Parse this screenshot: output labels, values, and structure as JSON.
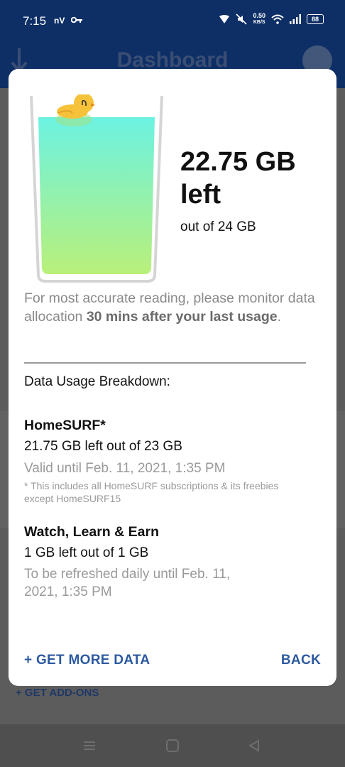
{
  "status_bar": {
    "time": "7:15",
    "carrier": "nV",
    "speed_value": "0.50",
    "speed_unit": "KB/S",
    "battery": "88"
  },
  "app_header": {
    "title": "Dashboard"
  },
  "dialog": {
    "remaining": "22.75 GB left",
    "total": "out of 24 GB",
    "note_prefix": "For most accurate reading, please monitor data allocation ",
    "note_bold": "30 mins after your last usage",
    "note_suffix": ".",
    "breakdown_title": "Data Usage Breakdown:",
    "items": [
      {
        "name": "HomeSURF*",
        "left": "21.75 GB left out of 23 GB",
        "valid": "Valid until Feb. 11, 2021, 1:35 PM",
        "footnote": "* This includes all HomeSURF subscriptions & its freebies except HomeSURF15"
      },
      {
        "name": "Watch, Learn & Earn",
        "left": "1 GB left out of 1 GB",
        "valid": "To be refreshed daily until Feb. 11, 2021, 1:35 PM"
      }
    ],
    "get_more_label": "+ GET MORE DATA",
    "back_label": "BACK"
  },
  "background": {
    "add_ons_label": "+ GET ADD-ONS"
  },
  "colors": {
    "header": "#0e2f66",
    "accent": "#2d5aa0",
    "liquid_top": "#6cf2e2",
    "liquid_bottom": "#b9f07a",
    "duck": "#f6c23a"
  }
}
